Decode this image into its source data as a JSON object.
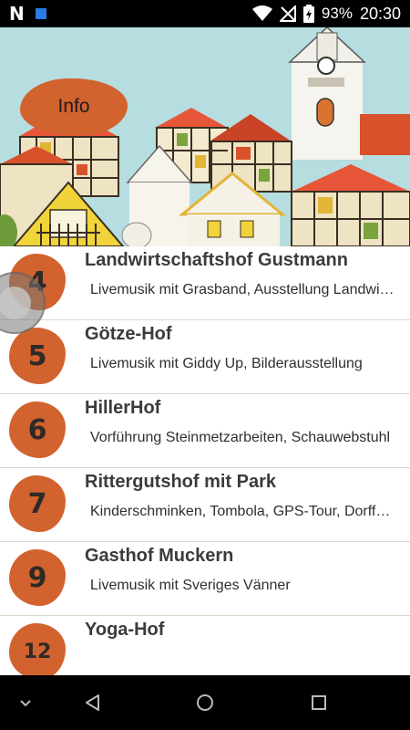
{
  "status_bar": {
    "battery": "93%",
    "time": "20:30"
  },
  "header": {
    "info_label": "Info"
  },
  "items": [
    {
      "number": "4",
      "title": "Landwirtschaftshof Gustmann",
      "desc": "Livemusik mit Grasband, Ausstellung Landwirtschaft"
    },
    {
      "number": "5",
      "title": "Götze-Hof",
      "desc": "Livemusik mit Giddy Up, Bilderausstellung"
    },
    {
      "number": "6",
      "title": "HillerHof",
      "desc": "Vorführung Steinmetzarbeiten, Schauwebstuhl"
    },
    {
      "number": "7",
      "title": "Rittergutshof mit Park",
      "desc": "Kinderschminken, Tombola, GPS-Tour, Dorfführung"
    },
    {
      "number": "9",
      "title": "Gasthof Muckern",
      "desc": "Livemusik mit Sveriges Vänner"
    },
    {
      "number": "12",
      "title": "Yoga-Hof",
      "desc": ""
    }
  ],
  "colors": {
    "accent": "#d2622e",
    "sky": "#b6dde0",
    "divider": "#d9d9c9"
  },
  "nav_bar": {
    "icons": [
      "chevron-down-icon",
      "back-icon",
      "home-icon",
      "recents-icon"
    ]
  }
}
